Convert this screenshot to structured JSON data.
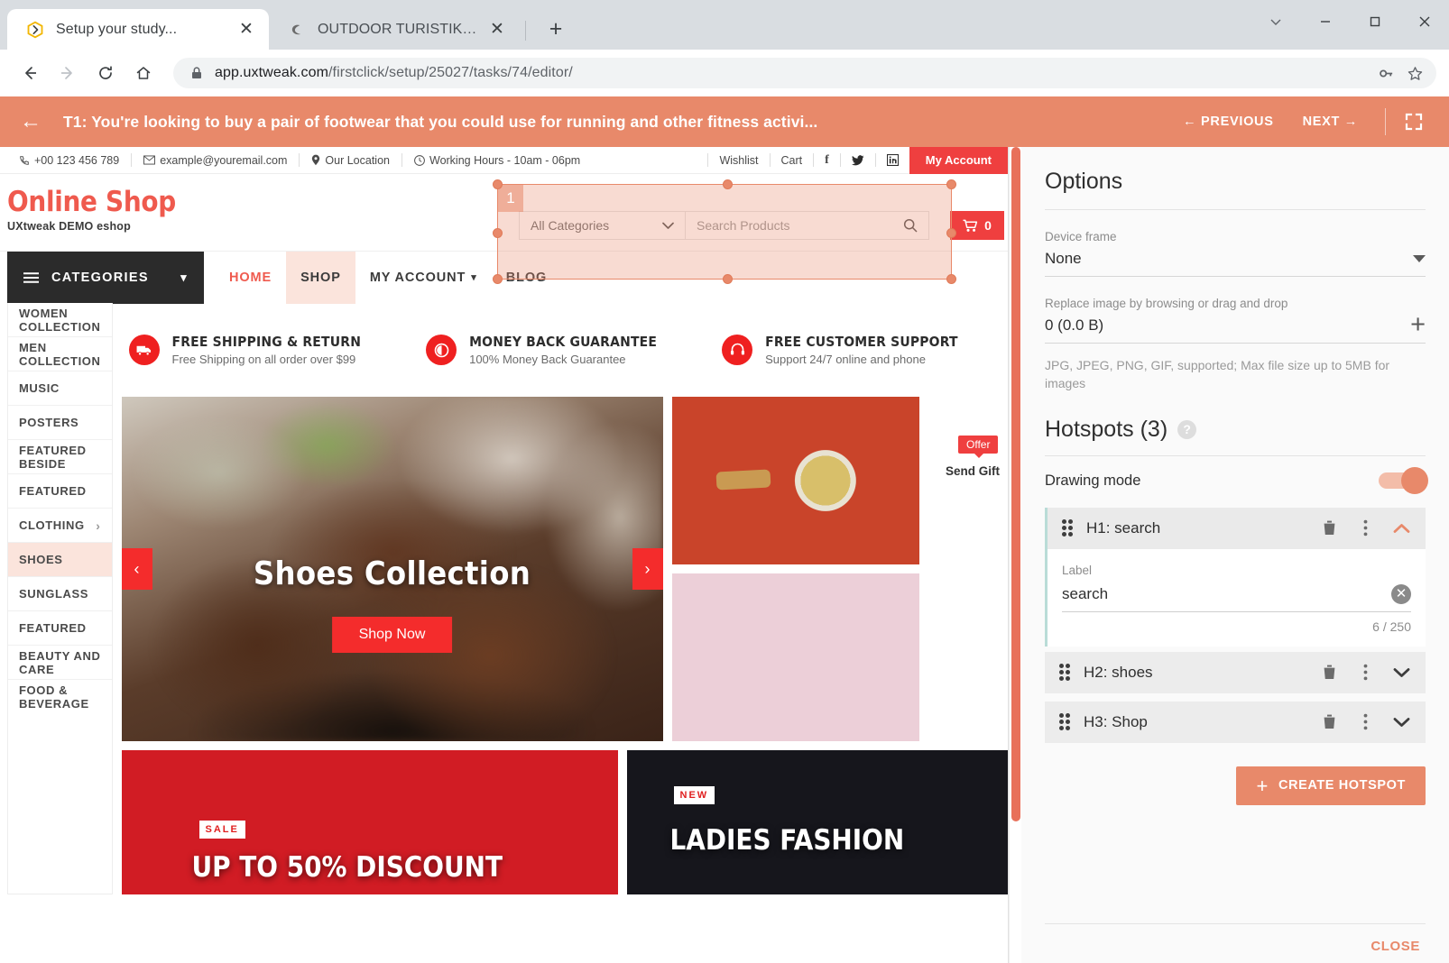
{
  "browser": {
    "tabs": [
      {
        "title": "Setup your study...",
        "favicon": "uxtweak-icon",
        "active": true
      },
      {
        "title": "OUTDOOR TURISTIKA ECCO MX",
        "favicon": "ecco-icon",
        "active": false
      }
    ],
    "new_tab_label": "+",
    "window_controls": {
      "more": "chevron-down-icon",
      "minimize": "—",
      "maximize": "□",
      "close": "✕"
    },
    "toolbar": {
      "back": "←",
      "forward": "→",
      "reload": "⟳",
      "home": "⌂",
      "url_prefix": "app.uxtweak.com",
      "url_path": "/firstclick/setup/25027/tasks/74/editor/",
      "lock": "lock-icon",
      "password_key": "key-icon",
      "bookmark": "star-icon"
    }
  },
  "taskbar": {
    "back": "←",
    "task": "T1: You're looking to buy a pair of footwear that you could use for running and other fitness activi...",
    "previous": "← PREVIOUS",
    "next": "NEXT →",
    "fullscreen": "fullscreen-icon",
    "color": "#e8896a"
  },
  "site": {
    "topbar": {
      "phone": "+00 123 456 789",
      "email": "example@youremail.com",
      "location": "Our Location",
      "hours": "Working Hours - 10am - 06pm",
      "wishlist": "Wishlist",
      "cart": "Cart",
      "socials": [
        "facebook-icon",
        "twitter-icon",
        "linkedin-icon"
      ],
      "my_account": "My Account"
    },
    "logo": {
      "main": "Online Shop",
      "sub": "UXtweak DEMO eshop",
      "color": "#ef5a4e"
    },
    "search": {
      "category_value": "All Categories",
      "placeholder": "Search Products",
      "icon": "search-icon"
    },
    "cart": {
      "icon": "cart-icon",
      "count": "0"
    },
    "offer_tag": "Offer",
    "send_gift": "Send Gift",
    "categories_header": "CATEGORIES",
    "categories": [
      {
        "label": "WOMEN COLLECTION",
        "arrow": false,
        "highlight": false
      },
      {
        "label": "MEN COLLECTION",
        "arrow": false,
        "highlight": false
      },
      {
        "label": "MUSIC",
        "arrow": false,
        "highlight": false
      },
      {
        "label": "POSTERS",
        "arrow": false,
        "highlight": false
      },
      {
        "label": "FEATURED BESIDE",
        "arrow": false,
        "highlight": false
      },
      {
        "label": "FEATURED",
        "arrow": false,
        "highlight": false
      },
      {
        "label": "CLOTHING",
        "arrow": true,
        "highlight": false
      },
      {
        "label": "SHOES",
        "arrow": false,
        "highlight": true
      },
      {
        "label": "SUNGLASS",
        "arrow": false,
        "highlight": false
      },
      {
        "label": "FEATURED",
        "arrow": false,
        "highlight": false
      },
      {
        "label": "BEAUTY AND CARE",
        "arrow": false,
        "highlight": false
      },
      {
        "label": "FOOD & BEVERAGE",
        "arrow": false,
        "highlight": false
      }
    ],
    "nav": [
      {
        "label": "HOME",
        "active": true,
        "highlight": false,
        "caret": false
      },
      {
        "label": "SHOP",
        "active": false,
        "highlight": true,
        "caret": false
      },
      {
        "label": "MY ACCOUNT",
        "active": false,
        "highlight": false,
        "caret": true
      },
      {
        "label": "BLOG",
        "active": false,
        "highlight": false,
        "caret": false
      }
    ],
    "features": [
      {
        "icon": "truck-icon",
        "title": "FREE SHIPPING & RETURN",
        "sub": "Free Shipping on all order over $99"
      },
      {
        "icon": "coin-icon",
        "title": "MONEY BACK GUARANTEE",
        "sub": "100% Money Back Guarantee"
      },
      {
        "icon": "headset-icon",
        "title": "FREE CUSTOMER SUPPORT",
        "sub": "Support 24/7 online and phone"
      }
    ],
    "hero": {
      "title": "Shoes Collection",
      "button": "Shop Now",
      "prev": "‹",
      "next": "›"
    },
    "promos": [
      {
        "badge": "SALE",
        "title": "UP TO 50% DISCOUNT"
      },
      {
        "badge": "NEW",
        "title": "LADIES FASHION"
      }
    ]
  },
  "hotspot_overlay": {
    "number": "1"
  },
  "panel": {
    "title": "Options",
    "device_frame": {
      "label": "Device frame",
      "value": "None"
    },
    "replace_image": {
      "label": "Replace image by browsing or drag and drop",
      "value": "0 (0.0 B)",
      "add": "+"
    },
    "file_hint": "JPG, JPEG, PNG, GIF, supported; Max file size up to 5MB for images",
    "hotspots_title": "Hotspots (3)",
    "help": "?",
    "drawing_mode": {
      "label": "Drawing mode",
      "enabled": true
    },
    "hotspots": [
      {
        "name": "H1: search",
        "expanded": true,
        "label_caption": "Label",
        "label_value": "search",
        "counter": "6 / 250",
        "clear": "✕",
        "delete": "trash-icon",
        "more": "more-vertical-icon",
        "chevron": "chevron-up-icon"
      },
      {
        "name": "H2: shoes",
        "expanded": false,
        "delete": "trash-icon",
        "more": "more-vertical-icon",
        "chevron": "chevron-down-icon"
      },
      {
        "name": "H3: Shop",
        "expanded": false,
        "delete": "trash-icon",
        "more": "more-vertical-icon",
        "chevron": "chevron-down-icon"
      }
    ],
    "create_hotspot": "CREATE HOTSPOT",
    "create_plus": "+",
    "close": "CLOSE",
    "accent": "#e8896a"
  }
}
